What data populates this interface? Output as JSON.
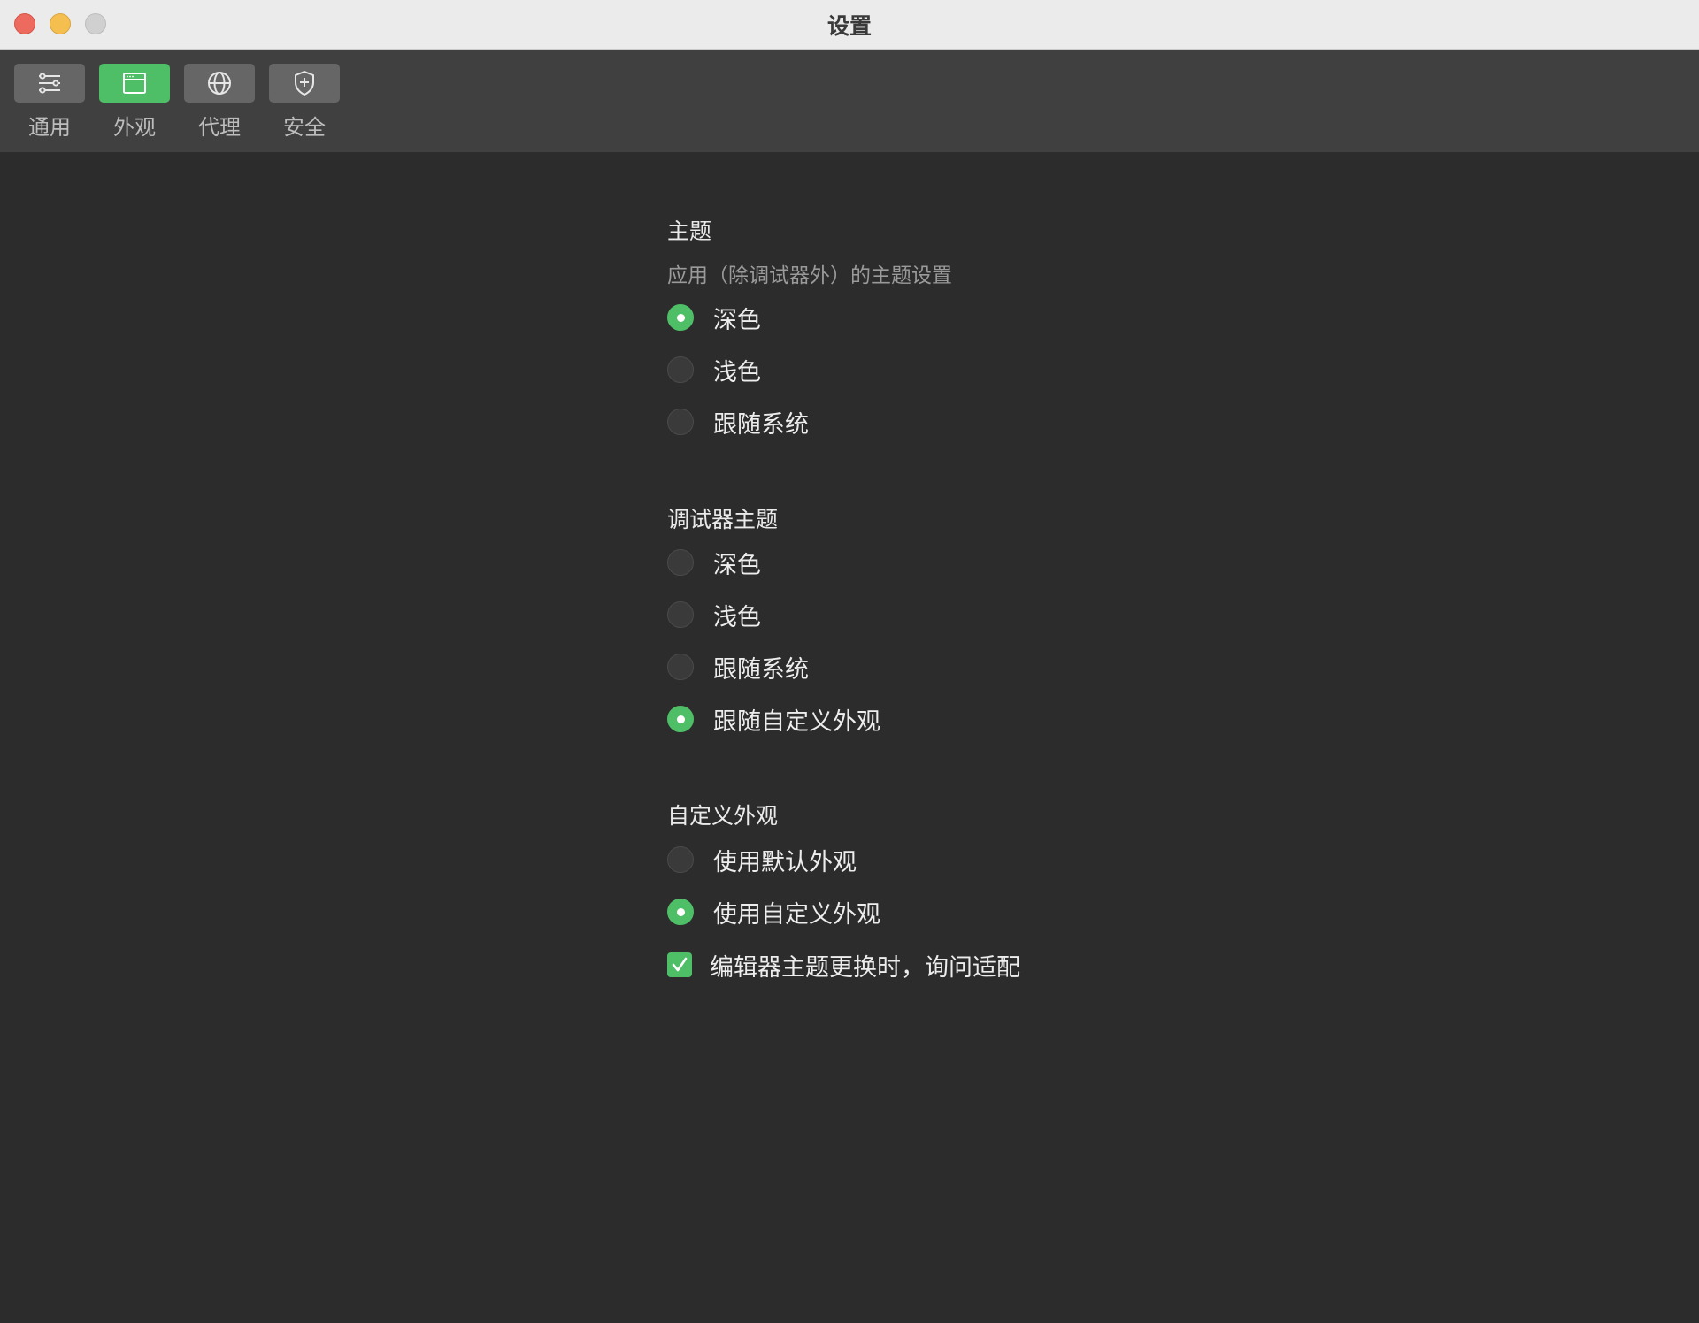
{
  "window": {
    "title": "设置"
  },
  "toolbar": {
    "items": [
      {
        "label": "通用",
        "icon": "sliders-icon",
        "active": false
      },
      {
        "label": "外观",
        "icon": "window-icon",
        "active": true
      },
      {
        "label": "代理",
        "icon": "globe-icon",
        "active": false
      },
      {
        "label": "安全",
        "icon": "shield-icon",
        "active": false
      }
    ]
  },
  "theme": {
    "title": "主题",
    "subtitle": "应用（除调试器外）的主题设置",
    "options": [
      {
        "label": "深色",
        "selected": true
      },
      {
        "label": "浅色",
        "selected": false
      },
      {
        "label": "跟随系统",
        "selected": false
      }
    ]
  },
  "debugger_theme": {
    "title": "调试器主题",
    "options": [
      {
        "label": "深色",
        "selected": false
      },
      {
        "label": "浅色",
        "selected": false
      },
      {
        "label": "跟随系统",
        "selected": false
      },
      {
        "label": "跟随自定义外观",
        "selected": true
      }
    ]
  },
  "custom_appearance": {
    "title": "自定义外观",
    "options": [
      {
        "label": "使用默认外观",
        "selected": false
      },
      {
        "label": "使用自定义外观",
        "selected": true
      }
    ],
    "checkbox": {
      "label": "编辑器主题更换时，询问适配",
      "checked": true
    }
  },
  "colors": {
    "accent": "#4fbf67",
    "background": "#2c2c2c",
    "toolbar": "#404040"
  }
}
